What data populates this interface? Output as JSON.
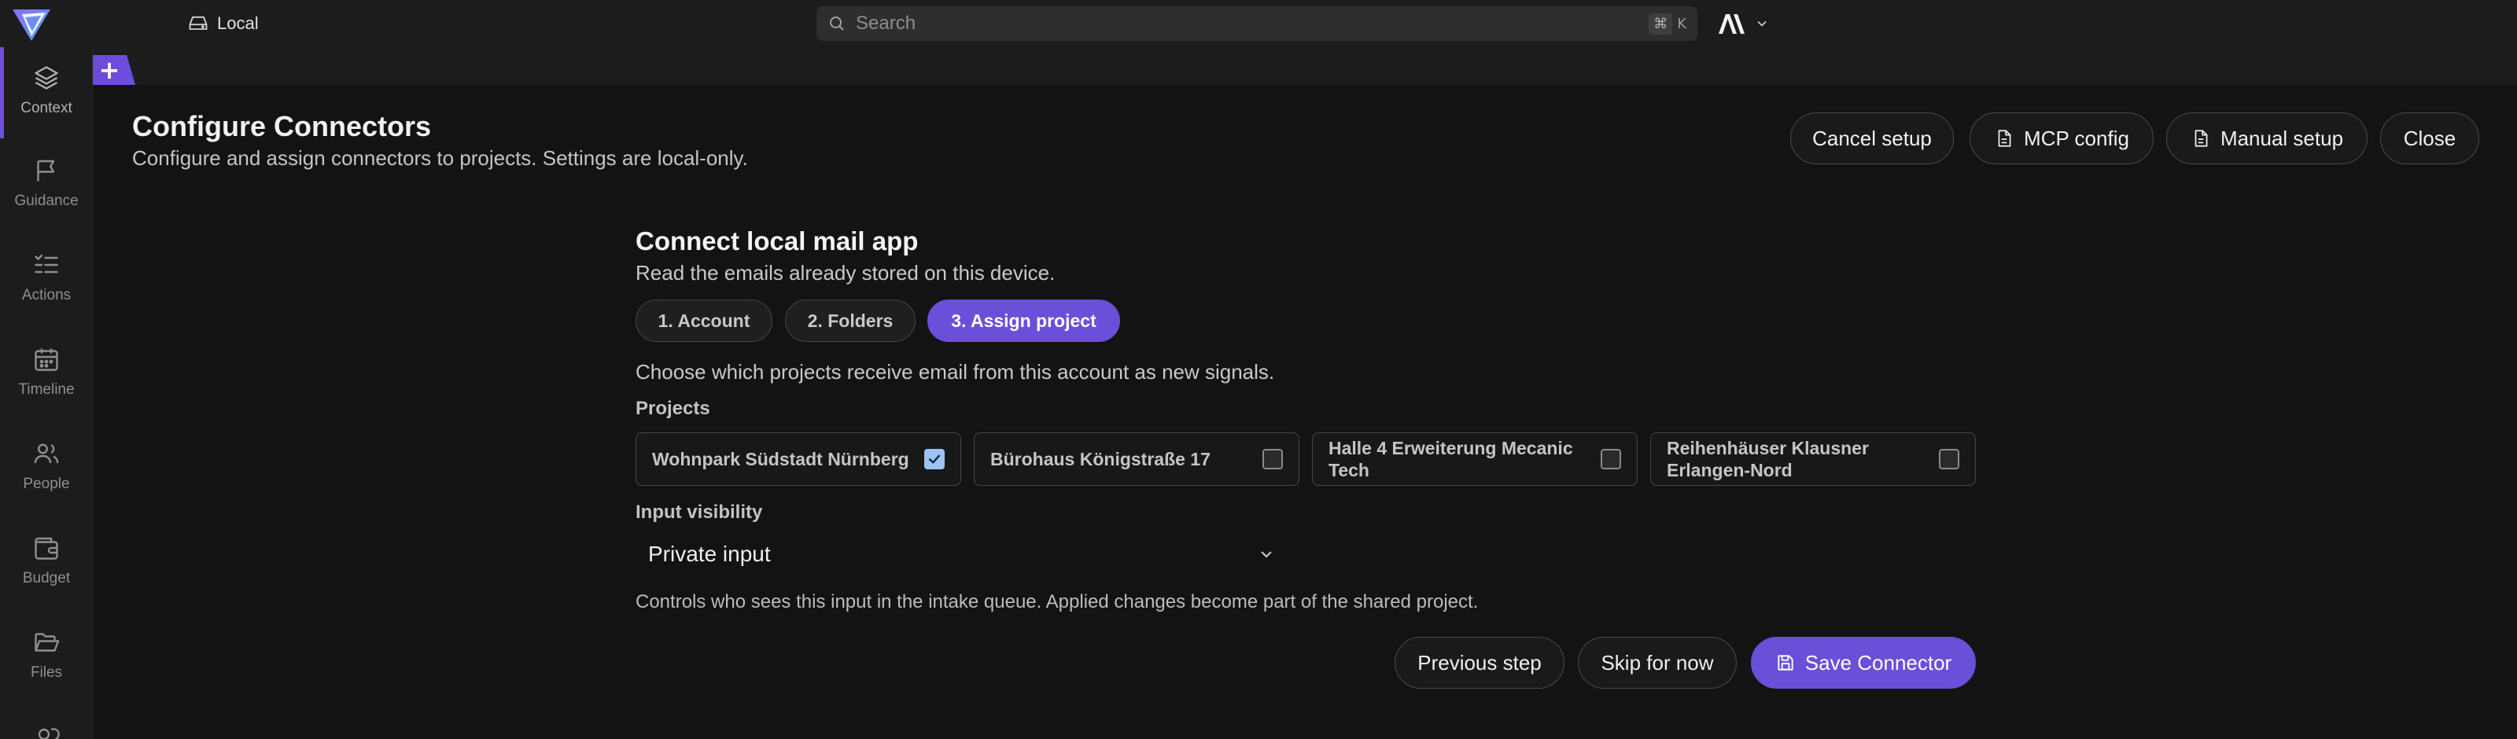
{
  "topbar": {
    "workspace_label": "Local",
    "search_placeholder": "Search",
    "shortcut_mod": "⌘",
    "shortcut_key": "K",
    "brand": "AI"
  },
  "sidebar": {
    "items": [
      {
        "label": "Context",
        "icon": "layers-icon",
        "active": true
      },
      {
        "label": "Guidance",
        "icon": "flag-icon"
      },
      {
        "label": "Actions",
        "icon": "checklist-icon"
      },
      {
        "label": "Timeline",
        "icon": "calendar-icon"
      },
      {
        "label": "People",
        "icon": "people-icon"
      },
      {
        "label": "Budget",
        "icon": "wallet-icon"
      },
      {
        "label": "Files",
        "icon": "folder-icon"
      }
    ]
  },
  "tabs": {
    "new_tab_label": "+"
  },
  "header": {
    "title": "Configure Connectors",
    "subtitle": "Configure and assign connectors to projects. Settings are local-only.",
    "buttons": {
      "cancel": "Cancel setup",
      "mcp": "MCP config",
      "manual": "Manual setup",
      "close": "Close"
    }
  },
  "wizard": {
    "title": "Connect local mail app",
    "subtitle": "Read the emails already stored on this device.",
    "steps": [
      {
        "label": "1. Account",
        "active": false
      },
      {
        "label": "2. Folders",
        "active": false
      },
      {
        "label": "3. Assign project",
        "active": true
      }
    ],
    "instruction": "Choose which projects receive email from this account as new signals.",
    "projects_label": "Projects",
    "projects": [
      {
        "name": "Wohnpark Südstadt Nürnberg",
        "checked": true
      },
      {
        "name": "Bürohaus Königstraße 17",
        "checked": false
      },
      {
        "name": "Halle 4 Erweiterung Mecanic Tech",
        "checked": false
      },
      {
        "name": "Reihenhäuser Klausner Erlangen-Nord",
        "checked": false
      }
    ],
    "visibility_label": "Input visibility",
    "visibility_value": "Private input",
    "visibility_help": "Controls who sees this input in the intake queue. Applied changes become part of the shared project.",
    "footer": {
      "previous": "Previous step",
      "skip": "Skip for now",
      "save": "Save Connector"
    }
  },
  "colors": {
    "accent": "#6a4fd8",
    "background": "#131313",
    "panel": "#1c1c1c",
    "checkbox_on": "#9cc4f2"
  }
}
